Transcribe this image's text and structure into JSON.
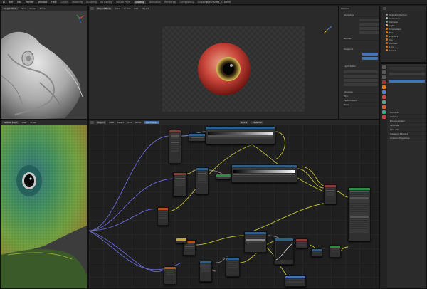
{
  "topbar": {
    "menus": [
      "File",
      "Edit",
      "Render",
      "Window",
      "Help"
    ],
    "workspaces": [
      "Layout",
      "Modeling",
      "Sculpting",
      "UV Editing",
      "Texture Paint",
      "Shading",
      "Animation",
      "Rendering",
      "Compositing",
      "Scripting"
    ],
    "active_workspace": "Shading",
    "window_title": "eyeshaders_01.blend"
  },
  "sculpt_view": {
    "header": [
      "Sculpt Mode",
      "View",
      "Sculpt",
      "Mask"
    ]
  },
  "eye_view": {
    "header": [
      "Object Mode",
      "View",
      "Select",
      "Add",
      "Object"
    ]
  },
  "texture_view": {
    "header": [
      "Texture Paint",
      "View",
      "Brush"
    ]
  },
  "node_editor": {
    "header": [
      "Object",
      "View",
      "Select",
      "Add",
      "Node",
      "Use Nodes"
    ],
    "slot": "Slot 1",
    "material": "Material"
  },
  "render_settings": {
    "header": [
      "Options"
    ],
    "rows": [
      "Sampling",
      "Render",
      "Viewport",
      "Light Paths",
      "Volumes",
      "Film",
      "Performance",
      "Bake",
      "Freestyle",
      "Color Management"
    ]
  },
  "outliner": {
    "title": "Scene Collection",
    "items": [
      "Collection",
      "Camera",
      "Light",
      "Chameleon",
      "Eye",
      "Eye.001",
      "Iris",
      "Cornea",
      "Lens",
      "Sclera"
    ]
  },
  "properties": {
    "panels": [
      "Surface",
      "Volume",
      "Displacement",
      "Settings",
      "Line Art",
      "Viewport Display",
      "Custom Properties"
    ]
  },
  "colors": {
    "accent": "#4772b3",
    "active_object": "#e07b1b",
    "node_shader": "#2b8c42",
    "node_texture": "#b84e1d",
    "node_input": "#8a3838",
    "node_converter": "#2d5f8a",
    "node_output": "#6b2424"
  }
}
